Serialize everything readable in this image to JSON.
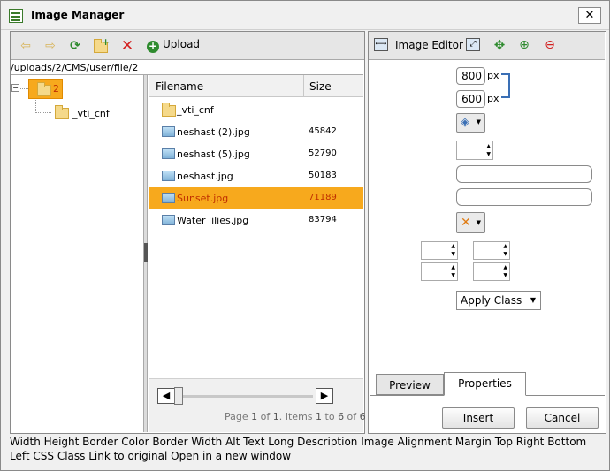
{
  "window": {
    "title": "Image Manager",
    "close_glyph": "✕"
  },
  "file_toolbar": {
    "back_icon": "arrow-left-icon",
    "forward_icon": "arrow-right-icon",
    "refresh_icon": "refresh-icon",
    "new_folder_icon": "new-folder-icon",
    "delete_icon": "delete-icon",
    "upload_label": "Upload"
  },
  "path": "/uploads/2/CMS/user/file/2",
  "tree": {
    "root_label": "2",
    "children": [
      {
        "label": "_vti_cnf"
      }
    ]
  },
  "list": {
    "headers": {
      "filename": "Filename",
      "size": "Size"
    },
    "rows": [
      {
        "name": "_vti_cnf",
        "size": "",
        "type": "folder"
      },
      {
        "name": "neshast (2).jpg",
        "size": "45842",
        "type": "image"
      },
      {
        "name": "neshast (5).jpg",
        "size": "52790",
        "type": "image"
      },
      {
        "name": "neshast.jpg",
        "size": "50183",
        "type": "image"
      },
      {
        "name": "Sunset.jpg",
        "size": "71189",
        "type": "image",
        "selected": true
      },
      {
        "name": "Water lilies.jpg",
        "size": "83794",
        "type": "image"
      }
    ],
    "pager": {
      "prefix": "Page ",
      "page": "1",
      "of": " of ",
      "total_pages": "1",
      "items_label": ". Items ",
      "from": "1",
      "to_label": " to ",
      "to": "6",
      "of2": " of ",
      "total_items": "6"
    }
  },
  "editor": {
    "title": "Image Editor",
    "width_value": "800",
    "height_value": "600",
    "unit": "px",
    "class_select": "Apply Class",
    "tabs": [
      "Preview",
      "Properties"
    ],
    "active_tab": "Properties"
  },
  "buttons": {
    "insert": "Insert",
    "cancel": "Cancel"
  },
  "status_text": "Width Height Border Color Border Width Alt Text Long Description Image Alignment Margin Top Right Bottom Left CSS Class Link to original Open in a new window",
  "colors": {
    "selection": "#f7a91d",
    "selected_text": "#c03000",
    "toolbar_bg": "#e6e6e6"
  }
}
